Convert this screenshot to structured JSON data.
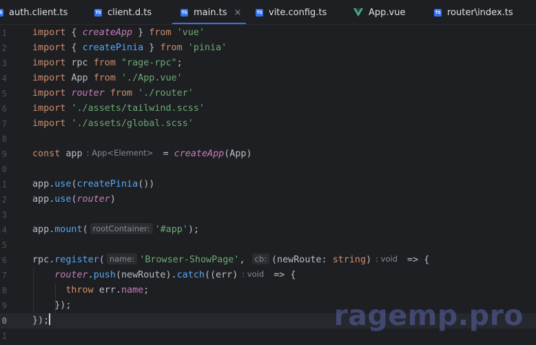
{
  "tabs": [
    {
      "label": "auth.client.ts",
      "icon": "typescript-file-icon",
      "active": false
    },
    {
      "label": "client.d.ts",
      "icon": "typescript-file-icon",
      "active": false
    },
    {
      "label": "main.ts",
      "icon": "typescript-file-icon",
      "active": true,
      "close": "×"
    },
    {
      "label": "vite.config.ts",
      "icon": "typescript-file-icon",
      "active": false
    },
    {
      "label": "App.vue",
      "icon": "vue-file-icon",
      "active": false
    },
    {
      "label": "router\\index.ts",
      "icon": "typescript-file-icon",
      "active": false
    }
  ],
  "ts_icon_text": "TS",
  "line_numbers": [
    "1",
    "2",
    "3",
    "4",
    "5",
    "6",
    "7",
    "8",
    "9",
    "0",
    "1",
    "2",
    "3",
    "4",
    "5",
    "6",
    "7",
    "8",
    "9",
    "0",
    "1"
  ],
  "code": {
    "l1": {
      "kw": "import",
      "b1": " { ",
      "name": "createApp",
      "b2": " } ",
      "kw2": "from",
      "sp": " ",
      "src": "'vue'"
    },
    "l2": {
      "kw": "import",
      "b1": " { ",
      "name": "createPinia",
      "b2": " } ",
      "kw2": "from",
      "sp": " ",
      "src": "'pinia'"
    },
    "l3": {
      "kw": "import",
      "sp": " ",
      "name": "rpc",
      "sp2": " ",
      "kw2": "from",
      "sp3": " ",
      "src": "\"rage-rpc\"",
      "end": ";"
    },
    "l4": {
      "kw": "import",
      "sp": " ",
      "name": "App",
      "sp2": " ",
      "kw2": "from",
      "sp3": " ",
      "src": "'./App.vue'"
    },
    "l5": {
      "kw": "import",
      "sp": " ",
      "name": "router",
      "sp2": " ",
      "kw2": "from",
      "sp3": " ",
      "src": "'./router'"
    },
    "l6": {
      "kw": "import",
      "sp": " ",
      "src": "'./assets/tailwind.scss'"
    },
    "l7": {
      "kw": "import",
      "sp": " ",
      "src": "'./assets/global.scss'"
    },
    "l9": {
      "kw": "const",
      "sp": " ",
      "name": "app",
      "hint": ": App<Element>",
      "eq": " = ",
      "fn": "createApp",
      "args": "(App)"
    },
    "l11": {
      "obj": "app",
      "dot": ".",
      "fn": "use",
      "open": "(",
      "arg": "createPinia",
      "close": "())"
    },
    "l12": {
      "obj": "app",
      "dot": ".",
      "fn": "use",
      "open": "(",
      "arg": "router",
      "close": ")"
    },
    "l14": {
      "obj": "app",
      "dot": ".",
      "fn": "mount",
      "open": "(",
      "hint": "rootContainer:",
      "arg": "'#app'",
      "close": ");"
    },
    "l16": {
      "obj": "rpc",
      "dot": ".",
      "fn": "register",
      "open": "(",
      "hint1": "name:",
      "arg1": "'Browser-ShowPage'",
      "comma": ",",
      "hint2": "cb:",
      "p_open": "(newRoute: ",
      "type": "string",
      "p_close": ")",
      "hint3": ": void",
      "arrow": " => {"
    },
    "l17": {
      "indent": "    ",
      "obj": "router",
      "dot": ".",
      "fn": "push",
      "mid": "(newRoute).",
      "fn2": "catch",
      "args": "((err)",
      "hint": ": void",
      "arrow": " => {"
    },
    "l18": {
      "indent": "      ",
      "kw": "throw",
      "sp": " ",
      "obj": "err",
      "dot": ".",
      "prop": "name",
      "end": ";"
    },
    "l19": {
      "indent": "    ",
      "text": "});"
    },
    "l20": {
      "text": "});"
    }
  },
  "watermark": "ragemp.pro",
  "colors": {
    "background": "#1e1f22",
    "keyword": "#cf8e6d",
    "string": "#6aab73",
    "function": "#56a8f5",
    "variable": "#c77dbb",
    "accent": "#3574f0"
  }
}
